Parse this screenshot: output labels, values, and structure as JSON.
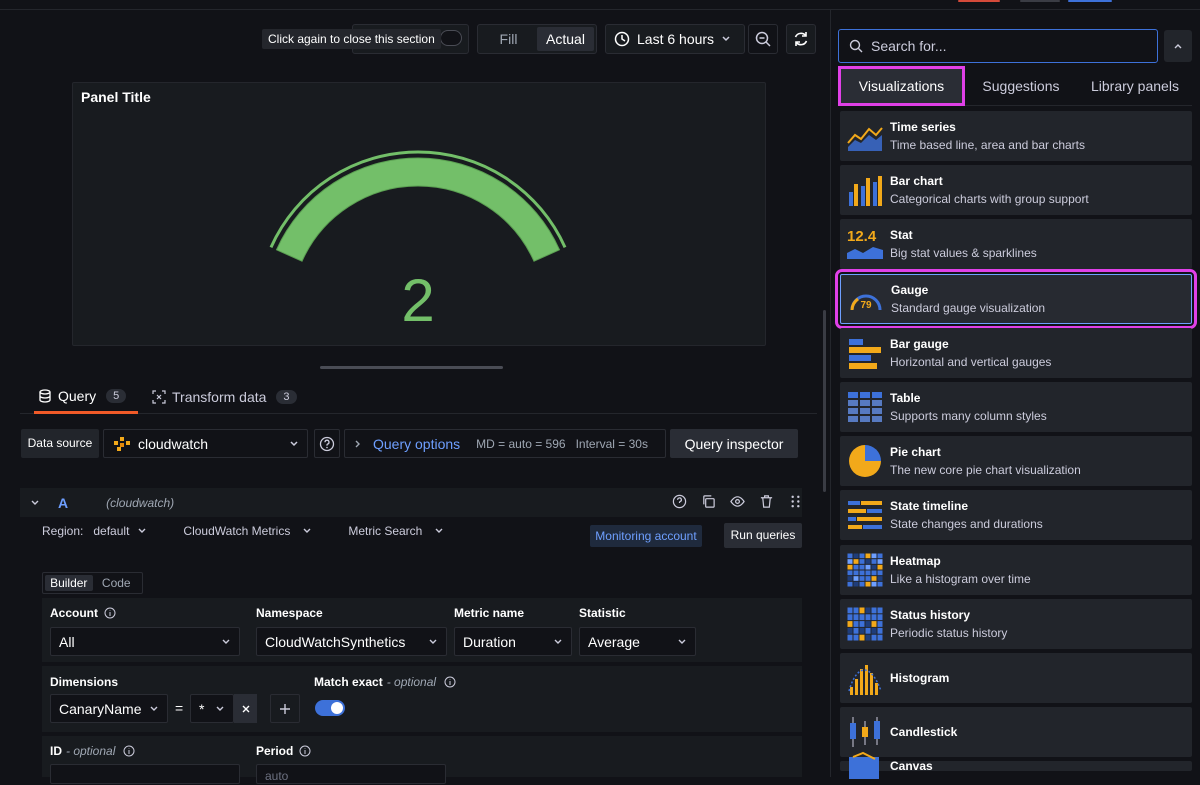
{
  "tooltip": "Click again to close this section",
  "view_toggle": {
    "fill": "Fill",
    "actual": "Actual"
  },
  "time_range": "Last 6 hours",
  "panel": {
    "title": "Panel Title",
    "value": "2",
    "gauge_fraction": 1.0,
    "gauge_color": "#73bf69"
  },
  "tabs": {
    "query": "Query",
    "query_count": "5",
    "transform": "Transform data",
    "transform_count": "3"
  },
  "datasource": {
    "label": "Data source",
    "name": "cloudwatch",
    "query_options": "Query options",
    "md": "MD = auto = 596",
    "interval": "Interval = 30s",
    "inspector": "Query inspector"
  },
  "query": {
    "ref": "A",
    "source": "(cloudwatch)",
    "region_label": "Region:",
    "region": "default",
    "service": "CloudWatch Metrics",
    "mode": "Metric Search",
    "monitoring": "Monitoring account",
    "run": "Run queries",
    "builder": "Builder",
    "code": "Code",
    "account_label": "Account",
    "account": "All",
    "namespace_label": "Namespace",
    "namespace": "CloudWatchSynthetics",
    "metric_label": "Metric name",
    "metric": "Duration",
    "stat_label": "Statistic",
    "stat": "Average",
    "dimensions_label": "Dimensions",
    "dim_key": "CanaryName",
    "dim_op": "=",
    "dim_val": "*",
    "match_label": "Match exact",
    "optional": "- optional",
    "id_label": "ID",
    "period_label": "Period",
    "period_value": "auto"
  },
  "right": {
    "search_placeholder": "Search for...",
    "tabs": [
      "Visualizations",
      "Suggestions",
      "Library panels"
    ],
    "items": [
      {
        "name": "Time series",
        "desc": "Time based line, area and bar charts",
        "icon": "time-series-icon"
      },
      {
        "name": "Bar chart",
        "desc": "Categorical charts with group support",
        "icon": "bar-chart-icon"
      },
      {
        "name": "Stat",
        "desc": "Big stat values & sparklines",
        "icon": "stat-icon",
        "icon_text": "12.4"
      },
      {
        "name": "Gauge",
        "desc": "Standard gauge visualization",
        "icon": "gauge-icon",
        "icon_text": "79"
      },
      {
        "name": "Bar gauge",
        "desc": "Horizontal and vertical gauges",
        "icon": "bar-gauge-icon"
      },
      {
        "name": "Table",
        "desc": "Supports many column styles",
        "icon": "table-icon"
      },
      {
        "name": "Pie chart",
        "desc": "The new core pie chart visualization",
        "icon": "pie-chart-icon"
      },
      {
        "name": "State timeline",
        "desc": "State changes and durations",
        "icon": "state-timeline-icon"
      },
      {
        "name": "Heatmap",
        "desc": "Like a histogram over time",
        "icon": "heatmap-icon"
      },
      {
        "name": "Status history",
        "desc": "Periodic status history",
        "icon": "status-history-icon"
      },
      {
        "name": "Histogram",
        "desc": "",
        "icon": "histogram-icon"
      },
      {
        "name": "Candlestick",
        "desc": "",
        "icon": "candlestick-icon"
      },
      {
        "name": "Canvas",
        "desc": "",
        "icon": "canvas-icon"
      }
    ]
  }
}
